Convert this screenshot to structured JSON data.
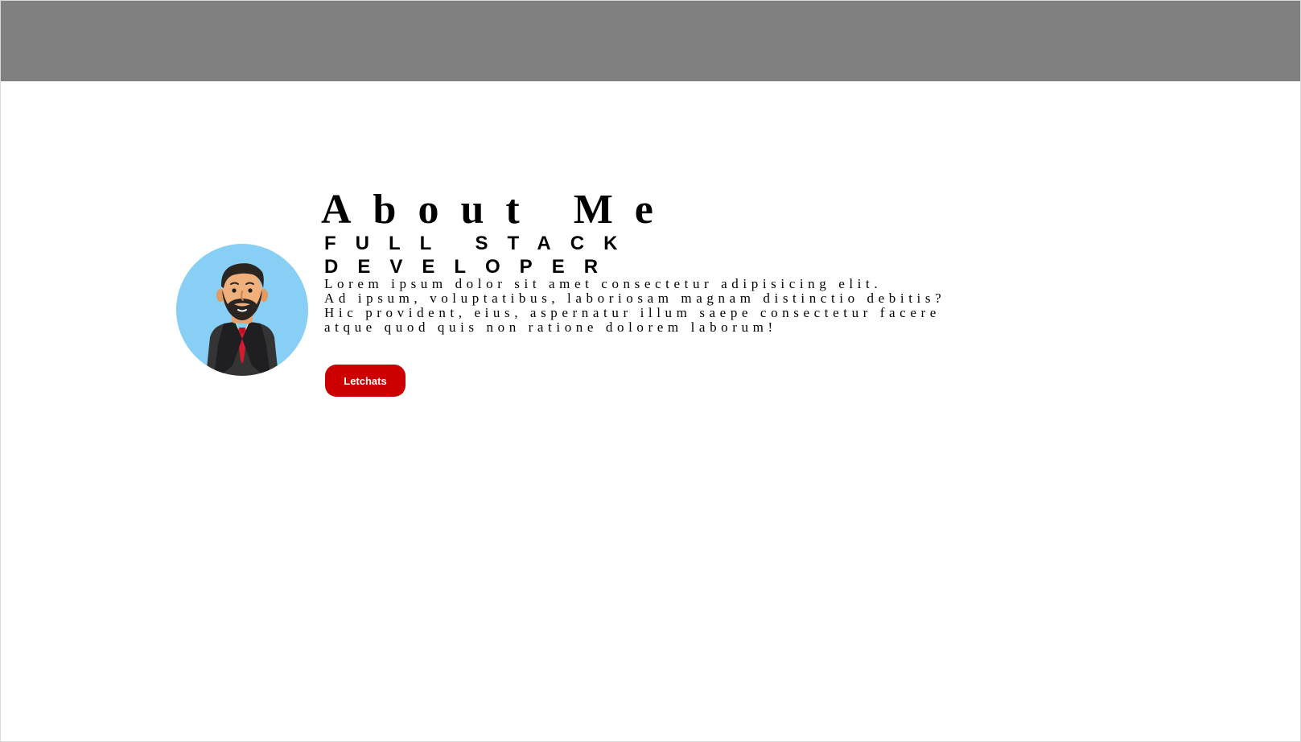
{
  "header": {
    "background": "#808080"
  },
  "about": {
    "title": "About Me",
    "subtitle_lines": [
      "FULL STACK",
      "DEVELOPER"
    ],
    "description_lines": [
      "Lorem ipsum dolor sit amet consectetur adipisicing elit.",
      "Ad ipsum, voluptatibus, laboriosam magnam distinctio debitis?",
      "Hic provident, eius, aspernatur illum saepe consectetur facere",
      "atque quod quis non ratione dolorem laborum!"
    ],
    "button_label": "Letchats",
    "avatar_icon": "businessman-avatar-icon"
  },
  "colors": {
    "accent": "#cc0000",
    "avatar_background": "#87cff5",
    "text": "#000000",
    "page_background": "#ffffff"
  }
}
